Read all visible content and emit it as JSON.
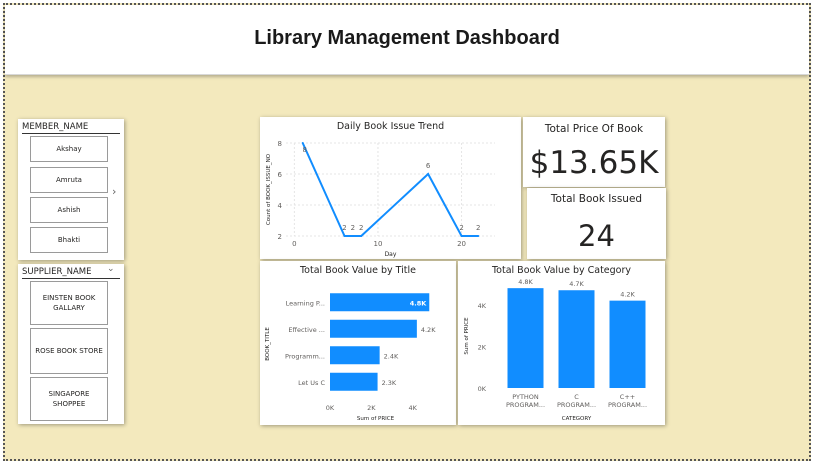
{
  "header": {
    "title": "Library Management Dashboard"
  },
  "member_slicer": {
    "title": "MEMBER_NAME",
    "items": [
      "Akshay",
      "Amruta",
      "Ashish",
      "Bhakti"
    ],
    "scroll_icon": "chevron-right-icon"
  },
  "supplier_slicer": {
    "title": "SUPPLIER_NAME",
    "dropdown_icon": "chevron-down-icon",
    "items": [
      "EINSTEN BOOK GALLARY",
      "ROSE BOOK STORE",
      "SINGAPORE SHOPPEE"
    ]
  },
  "kpi": {
    "total_price_title": "Total Price Of Book",
    "total_price_value": "$13.65K",
    "total_issued_title": "Total Book Issued",
    "total_issued_value": "24"
  },
  "colors": {
    "accent": "#118DFF",
    "background": "#F3E9BD"
  },
  "chart_data": [
    {
      "id": "daily-issue-trend",
      "type": "line",
      "title": "Daily Book Issue Trend",
      "xlabel": "Day",
      "ylabel": "Count of BOOK_ISSUE_NO",
      "x": [
        1,
        6,
        7,
        8,
        16,
        20,
        22
      ],
      "values": [
        8,
        2,
        2,
        2,
        6,
        2,
        2
      ],
      "data_labels": [
        "8",
        "2",
        "2",
        "2",
        "6",
        "2",
        "2"
      ],
      "xticks": [
        "0",
        "10",
        "20"
      ],
      "yticks": [
        "2",
        "4",
        "6",
        "8"
      ],
      "xlim": [
        -1,
        24
      ],
      "ylim": [
        2,
        8
      ],
      "grid": true
    },
    {
      "id": "value-by-title",
      "type": "bar",
      "orientation": "horizontal",
      "title": "Total Book Value by Title",
      "xlabel": "Sum of PRICE",
      "ylabel": "BOOK_TITLE",
      "categories": [
        "Learning P...",
        "Effective ...",
        "Programm...",
        "Let Us C"
      ],
      "values": [
        4800,
        4200,
        2400,
        2300
      ],
      "data_labels": [
        "4.8K",
        "4.2K",
        "2.4K",
        "2.3K"
      ],
      "xticks": [
        "0K",
        "2K",
        "4K"
      ],
      "xlim": [
        0,
        4400
      ],
      "grid": false
    },
    {
      "id": "value-by-category",
      "type": "bar",
      "orientation": "vertical",
      "title": "Total Book Value by Category",
      "xlabel": "CATEGORY",
      "ylabel": "Sum of PRICE",
      "categories": [
        [
          "PYTHON",
          "PROGRAM..."
        ],
        [
          "C",
          "PROGRAM..."
        ],
        [
          "C++",
          "PROGRAM..."
        ]
      ],
      "values": [
        4800,
        4700,
        4200
      ],
      "data_labels": [
        "4.8K",
        "4.7K",
        "4.2K"
      ],
      "yticks": [
        "0K",
        "2K",
        "4K"
      ],
      "ylim": [
        0,
        5000
      ],
      "grid": false
    }
  ]
}
